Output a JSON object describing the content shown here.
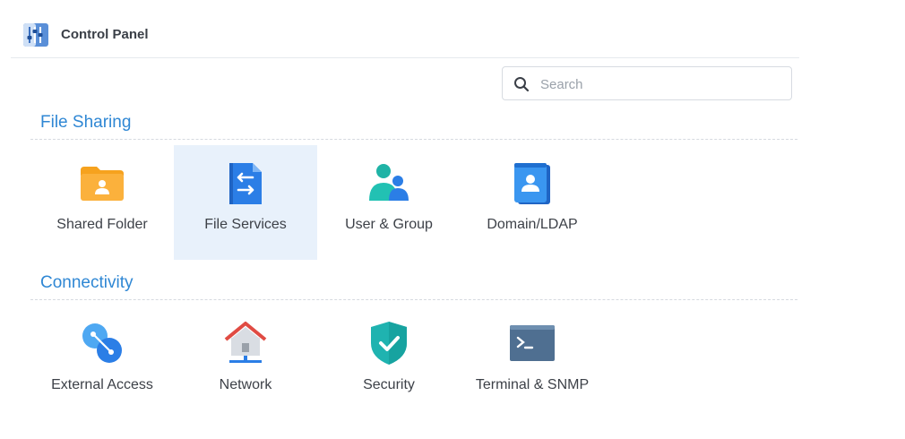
{
  "window": {
    "title": "Control Panel",
    "icon": "control-panel-icon"
  },
  "search": {
    "placeholder": "Search",
    "icon": "search-icon"
  },
  "sections": [
    {
      "title": "File Sharing",
      "items": [
        {
          "label": "Shared Folder",
          "icon": "shared-folder-icon",
          "selected": false
        },
        {
          "label": "File Services",
          "icon": "file-services-icon",
          "selected": true
        },
        {
          "label": "User & Group",
          "icon": "user-group-icon",
          "selected": false
        },
        {
          "label": "Domain/LDAP",
          "icon": "domain-ldap-icon",
          "selected": false
        }
      ]
    },
    {
      "title": "Connectivity",
      "items": [
        {
          "label": "External Access",
          "icon": "external-access-icon",
          "selected": false
        },
        {
          "label": "Network",
          "icon": "network-icon",
          "selected": false
        },
        {
          "label": "Security",
          "icon": "security-icon",
          "selected": false
        },
        {
          "label": "Terminal & SNMP",
          "icon": "terminal-snmp-icon",
          "selected": false
        }
      ]
    }
  ],
  "colors": {
    "accent": "#2f87d4",
    "selected_bg": "#e8f1fb"
  }
}
